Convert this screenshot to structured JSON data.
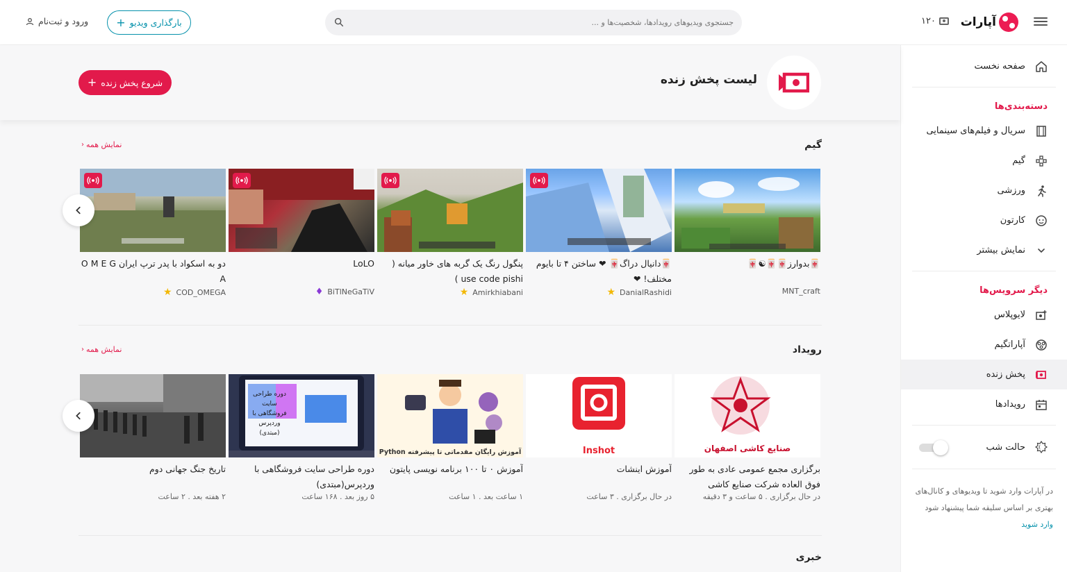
{
  "header": {
    "brand": "آپارات",
    "coins": "۱۲۰",
    "search_placeholder": "جستجوی ویدیوهای رویدادها، شخصیت‌ها و ...",
    "upload_label": "بارگذاری ویدیو",
    "login_label": "ورود و ثبت‌نام"
  },
  "sidebar": {
    "home": "صفحه نخست",
    "categories_heading": "دسته‌بندی‌ها",
    "categories": [
      "سریال و فیلم‌های سینمایی",
      "گیم",
      "ورزشی",
      "کارتون",
      "نمایش بیشتر"
    ],
    "services_heading": "دیگر سرویس‌ها",
    "services": [
      "لایوپلاس",
      "آپاراتگیم",
      "پخش زنده",
      "رویدادها"
    ],
    "night_mode": "حالت شب",
    "note": "در آپارات وارد شوید تا ویدیوهای و کانال‌های بهتری بر اساس سلیقه شما پیشنهاد شود",
    "note_link": "وارد شوید"
  },
  "banner": {
    "title": "لیست پخش زنده",
    "start_live": "شروع پخش زنده"
  },
  "sections": {
    "game": {
      "title": "گیم",
      "show_all": "نمایش همه",
      "cards": [
        {
          "title": "🀄بدوارز🀄🀄☯🀄",
          "channel": "MNT_craft",
          "badge": ""
        },
        {
          "title": "🀄دانیال دراگ🀄 ❤ ساختن ۴ تا بایوم مختلف! ❤",
          "channel": "DanialRashidi",
          "badge": "star"
        },
        {
          "title": "پنگول رنگ یک گربه های خاور میانه ( use code pishi )",
          "channel": "Amirkhiabani",
          "badge": "star"
        },
        {
          "title": "LoLO",
          "channel": "BiTlNeGaTiV",
          "badge": "diamond"
        },
        {
          "title": "دو به اسکواد با پدر ترپ ایران O M E G A",
          "channel": "COD_OMEGA",
          "badge": "star"
        }
      ]
    },
    "events": {
      "title": "رویداد",
      "show_all": "نمایش همه",
      "cards": [
        {
          "title": "برگزاری مجمع عمومی عادی به طور فوق العاده شرکت صنایع کاشی",
          "meta": "در حال برگزاری . ۵ ساعت و ۳ دقیقه",
          "art_text": "صنایع کاشی اصفهان"
        },
        {
          "title": "آموزش اینشات",
          "meta": "در حال برگزاری . ۳ ساعت",
          "art_text": "Inshot"
        },
        {
          "title": "آموزش ۰ تا ۱۰۰ برنامه نویسی پایتون",
          "meta": "۱ ساعت بعد . ۱ ساعت",
          "art_text": "آموزش رایگان مقدماتی تا پیشرفته Python"
        },
        {
          "title": "دوره طراحی سایت فروشگاهی با وردپرس(مبتدی)",
          "meta": "۵ روز بعد . ۱۶۸ ساعت",
          "art_text": "دوره طراحی سایت فروشگاهی با وردپرس (مبتدی)"
        },
        {
          "title": "تاریخ جنگ جهانی دوم",
          "meta": "۲ هفته بعد . ۲ ساعت",
          "art_text": ""
        }
      ]
    },
    "news": {
      "title": "خبری"
    }
  },
  "colors": {
    "brand": "#e21a4b",
    "accent": "#0591ab"
  }
}
